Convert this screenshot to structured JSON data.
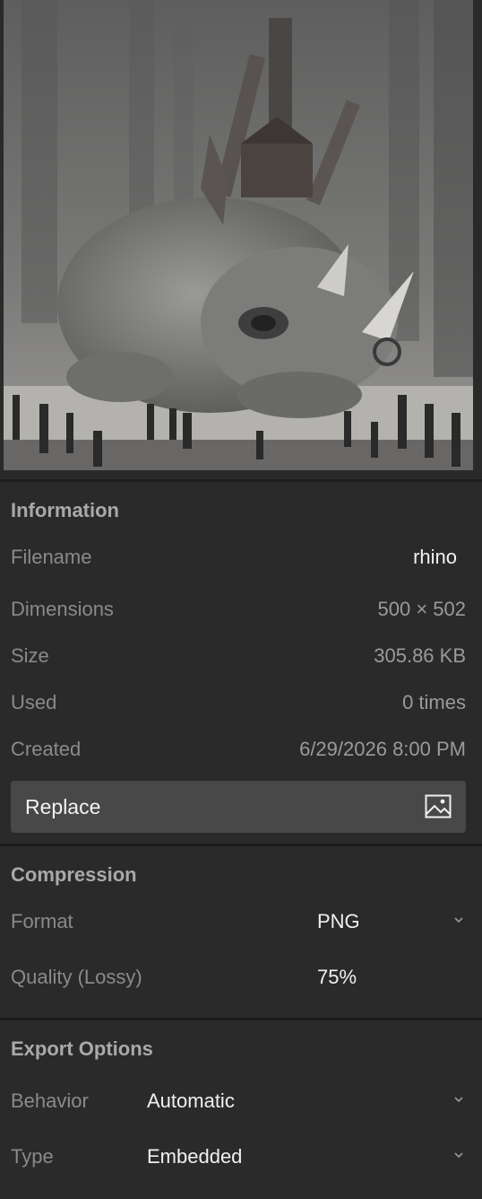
{
  "preview": {
    "icon": "image-preview-thumbnail"
  },
  "information": {
    "title": "Information",
    "rows": [
      {
        "label": "Filename",
        "value": "rhino"
      },
      {
        "label": "Dimensions",
        "value": "500 × 502"
      },
      {
        "label": "Size",
        "value": "305.86 KB"
      },
      {
        "label": "Used",
        "value": "0 times"
      },
      {
        "label": "Created",
        "value": "6/29/2026 8:00 PM"
      }
    ],
    "replace_label": "Replace",
    "replace_icon": "image-icon"
  },
  "compression": {
    "title": "Compression",
    "format_label": "Format",
    "format_value": "PNG",
    "quality_label": "Quality (Lossy)",
    "quality_value": "75%"
  },
  "export": {
    "title": "Export Options",
    "behavior_label": "Behavior",
    "behavior_value": "Automatic",
    "type_label": "Type",
    "type_value": "Embedded"
  },
  "colors": {
    "background": "#2a2a2a",
    "button": "#484848",
    "divider": "#1c1c1c"
  }
}
